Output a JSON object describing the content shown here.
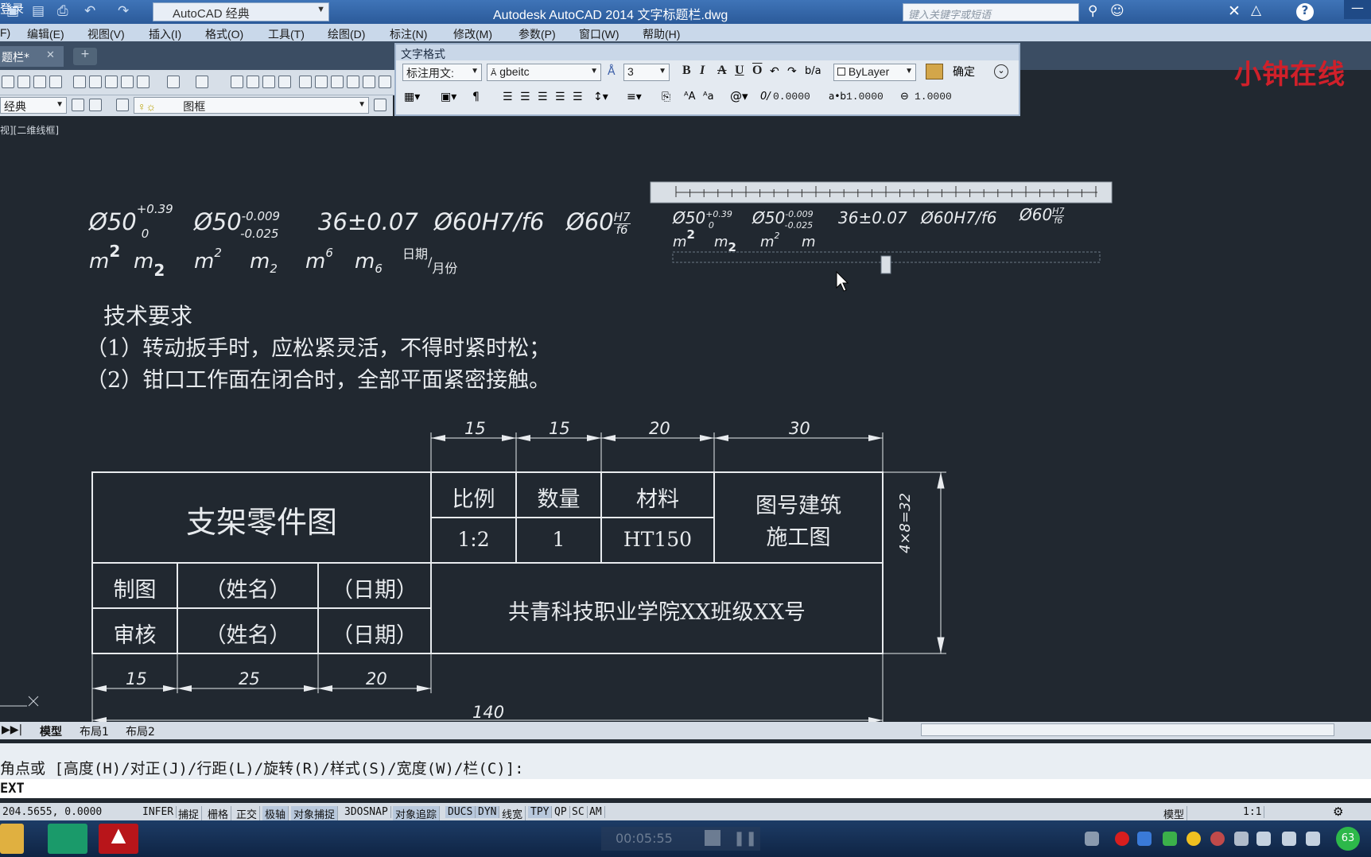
{
  "titlebar": {
    "workspace": "AutoCAD 经典",
    "app_title": "Autodesk AutoCAD 2014    文字标题栏.dwg",
    "search_placeholder": "键入关键字或短语",
    "login": "登录"
  },
  "menubar": {
    "items": [
      "F)",
      "编辑(E)",
      "视图(V)",
      "插入(I)",
      "格式(O)",
      "工具(T)",
      "绘图(D)",
      "标注(N)",
      "修改(M)",
      "参数(P)",
      "窗口(W)",
      "帮助(H)"
    ]
  },
  "doc_tab": {
    "label": "题栏*",
    "close": "✕",
    "new": "+"
  },
  "toolbar": {
    "workspace2": "经典",
    "layer": "图框"
  },
  "viewport_label": "视][二维线框]",
  "watermark": "小钟在线",
  "text_format": {
    "title": "文字格式",
    "style": "标注用文:",
    "font": "gbeitc",
    "height": "3",
    "color": "ByLayer",
    "ok_label": "确定",
    "oblique": "0.0000",
    "tracking": "1.0000",
    "width_factor": "1.0000",
    "bold": "B",
    "italic": "I",
    "strike": "A",
    "underline": "U",
    "overline": "O"
  },
  "drawing": {
    "row1": [
      "Ø50",
      "+0.39",
      "0",
      "Ø50",
      "-0.009",
      "-0.025",
      "36±0.07",
      "Ø60H7/f6",
      "Ø60",
      "H7",
      "f6"
    ],
    "row2": [
      "m",
      "2",
      "m",
      "2",
      "m",
      "2",
      "m",
      "2",
      "m",
      "6",
      "m",
      "6",
      "日期",
      "月份"
    ],
    "mtext_row1": [
      "Ø50",
      "+0.39",
      "0",
      "Ø50",
      "-0.009",
      "-0.025",
      "36±0.07",
      "Ø60H7/f6",
      "Ø60",
      "H7",
      "f6"
    ],
    "mtext_row2": [
      "m",
      "2",
      "m",
      "2",
      "m",
      "2",
      "m"
    ],
    "tech_title": "技术要求",
    "tech_lines": [
      "（1）转动扳手时，应松紧灵活，不得时紧时松；",
      "（2）钳口工作面在闭合时，全部平面紧密接触。"
    ]
  },
  "title_block": {
    "part_name": "支架零件图",
    "scale_label": "比例",
    "qty_label": "数量",
    "material_label": "材料",
    "drawing_no": [
      "图号建筑",
      "施工图"
    ],
    "scale": "1:2",
    "qty": "1",
    "material": "HT150",
    "drawn_label": "制图",
    "check_label": "审核",
    "name": "（姓名）",
    "date": "（日期）",
    "school": "共青科技职业学院XX班级XX号"
  },
  "dimensions": {
    "top": [
      "15",
      "15",
      "20",
      "30"
    ],
    "bottom": [
      "15",
      "25",
      "20"
    ],
    "total": "140",
    "height": "4×8=32"
  },
  "layout_tabs": [
    "模型",
    "布局1",
    "布局2"
  ],
  "command": {
    "prompt": "角点或 [高度(H)/对正(J)/行距(L)/旋转(R)/样式(S)/宽度(W)/栏(C)]:",
    "input": "EXT"
  },
  "status": {
    "coords": "204.5655, 0.0000",
    "toggles": [
      "INFER",
      "捕捉",
      "栅格",
      "正交",
      "极轴",
      "对象捕捉",
      "3DOSNAP",
      "对象追踪",
      "DUCS",
      "DYN",
      "线宽",
      "TPY",
      "QP",
      "SC",
      "AM"
    ],
    "model": "模型",
    "scale": "1:1"
  },
  "taskbar": {
    "clock": "00:05:55",
    "badge": "63"
  },
  "colors": {
    "canvas": "#212830",
    "titlebar": "#2b5a9a",
    "watermark": "#d0202a"
  }
}
